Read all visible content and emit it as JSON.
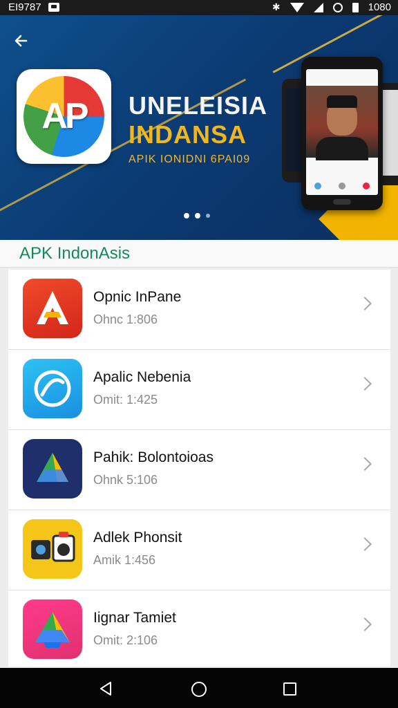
{
  "status_bar": {
    "left_text": "EI9787",
    "time": "1080",
    "icons": [
      "notification-icon",
      "bluetooth-icon",
      "wifi-icon",
      "signal-icon",
      "alarm-icon",
      "battery-icon"
    ]
  },
  "hero": {
    "logo_text": "AP",
    "title_line1": "UNELEISIA",
    "title_line2": "INDANSA",
    "subtitle": "APIK IONIDNI 6PAI09",
    "pager_active_index": 0,
    "pager_count": 3,
    "colors": {
      "background": "#0b3a72",
      "accent": "#f2b71e"
    }
  },
  "section": {
    "title": "APK IndonAsis",
    "color": "#16895a"
  },
  "apps": [
    {
      "name": "Opnic InPane",
      "meta": "Ohnc 1:806",
      "icon": "letter-a-icon"
    },
    {
      "name": "Apalic Nebenia",
      "meta": "Omit: 1:425",
      "icon": "circular-arrows-icon"
    },
    {
      "name": "Pahik: Bolontoioas",
      "meta": "Ohnk 5:106",
      "icon": "triangle-drive-icon"
    },
    {
      "name": "Adlek Phonsit",
      "meta": "Amik 1:456",
      "icon": "camera-speaker-icon"
    },
    {
      "name": "Iignar Tamiet",
      "meta": "Omit: 2:106",
      "icon": "drive-triangle-icon"
    }
  ],
  "nav": {
    "back": "back-icon",
    "home": "home-icon",
    "recents": "recents-icon"
  }
}
